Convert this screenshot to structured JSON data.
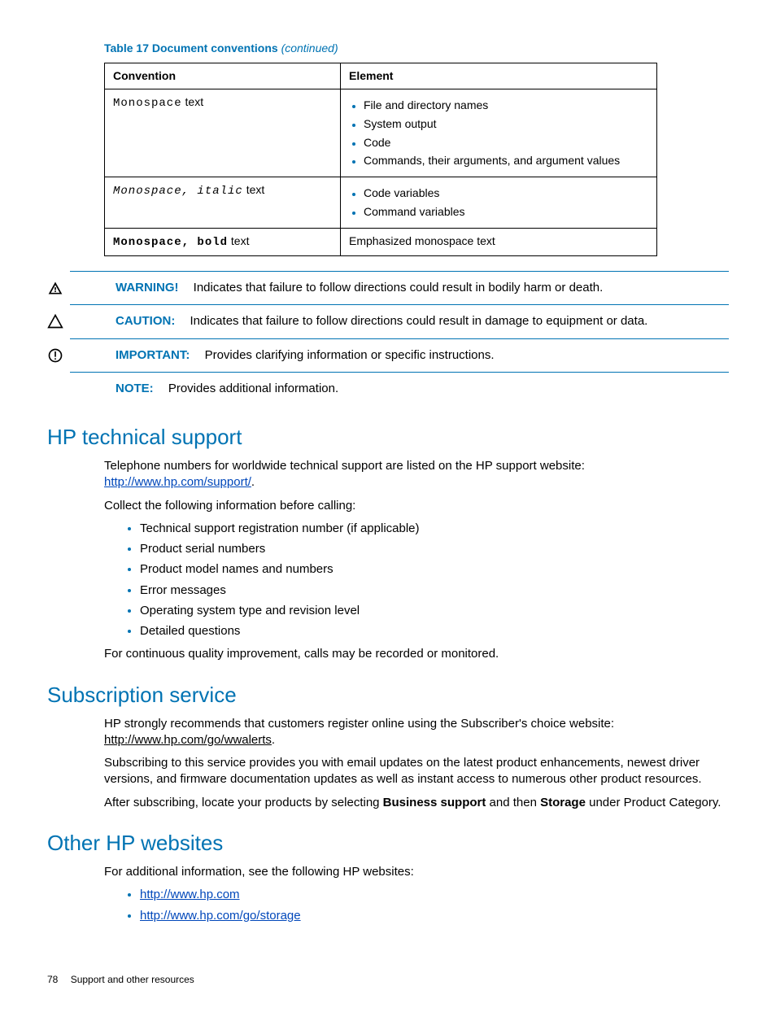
{
  "table": {
    "caption_prefix": "Table 17 Document conventions",
    "caption_suffix": "(continued)",
    "headers": {
      "c1": "Convention",
      "c2": "Element"
    },
    "rows": {
      "r1": {
        "conv_mono": "Monospace",
        "conv_tail": " text",
        "items": {
          "i1": "File and directory names",
          "i2": "System output",
          "i3": "Code",
          "i4": "Commands, their arguments, and argument values"
        }
      },
      "r2": {
        "conv_mono": "Monospace, italic",
        "conv_tail": " text",
        "items": {
          "i1": "Code variables",
          "i2": "Command variables"
        }
      },
      "r3": {
        "conv_mono": "Monospace, bold",
        "conv_tail": " text",
        "element": "Emphasized monospace text"
      }
    }
  },
  "admon": {
    "warning": {
      "label": "WARNING!",
      "text": "Indicates that failure to follow directions could result in bodily harm or death."
    },
    "caution": {
      "label": "CAUTION:",
      "text": "Indicates that failure to follow directions could result in damage to equipment or data."
    },
    "important": {
      "label": "IMPORTANT:",
      "text": "Provides clarifying information or specific instructions."
    },
    "note": {
      "label": "NOTE:",
      "text": "Provides additional information."
    }
  },
  "sections": {
    "hp_support": {
      "title": "HP technical support",
      "p1a": "Telephone numbers for worldwide technical support are listed on the HP support website: ",
      "link1": "http://www.hp.com/support/",
      "p1c": ".",
      "p2": "Collect the following information before calling:",
      "items": {
        "i1": "Technical support registration number (if applicable)",
        "i2": "Product serial numbers",
        "i3": "Product model names and numbers",
        "i4": "Error messages",
        "i5": "Operating system type and revision level",
        "i6": "Detailed questions"
      },
      "p3": "For continuous quality improvement, calls may be recorded or monitored."
    },
    "subscription": {
      "title": "Subscription service",
      "p1a": "HP strongly recommends that customers register online using the Subscriber's choice website: ",
      "link1": "http://www.hp.com/go/wwalerts",
      "p1c": ".",
      "p2": "Subscribing to this service provides you with email updates on the latest product enhancements, newest driver versions, and firmware documentation updates as well as instant access to numerous other product resources.",
      "p3a": "After subscribing, locate your products by selecting ",
      "p3b": "Business support",
      "p3c": " and then ",
      "p3d": "Storage",
      "p3e": " under Product Category."
    },
    "other": {
      "title": "Other HP websites",
      "p1": "For additional information, see the following HP websites:",
      "items": {
        "i1": "http://www.hp.com",
        "i2": "http://www.hp.com/go/storage"
      }
    }
  },
  "footer": {
    "page": "78",
    "title": "Support and other resources"
  }
}
